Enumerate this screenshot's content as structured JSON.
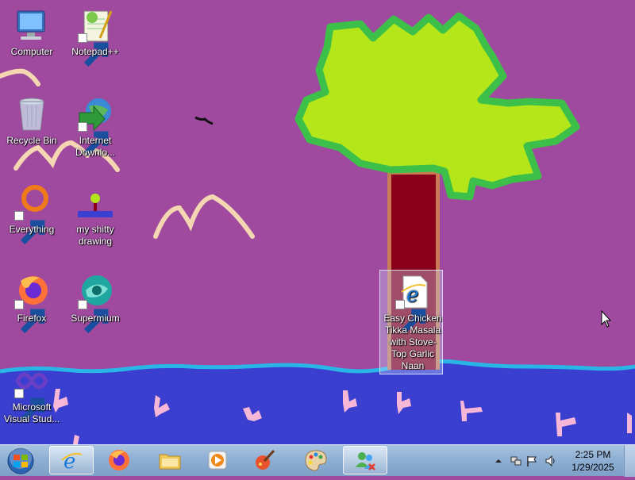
{
  "desktop": {
    "icons": [
      {
        "label": "Computer",
        "icon": "computer-icon"
      },
      {
        "label": "Notepad++",
        "icon": "notepad-plus-plus-icon"
      },
      {
        "label": "Recycle Bin",
        "icon": "recycle-bin-icon"
      },
      {
        "label": "Internet Downlo...",
        "icon": "internet-download-manager-icon"
      },
      {
        "label": "Everything",
        "icon": "everything-search-icon"
      },
      {
        "label": "my shitty drawing",
        "icon": "paint-image-icon"
      },
      {
        "label": "Firefox",
        "icon": "firefox-icon"
      },
      {
        "label": "Supermium",
        "icon": "supermium-icon"
      },
      {
        "label": "Microsoft Visual Stud...",
        "icon": "visual-studio-icon"
      },
      {
        "label": "Easy Chicken Tikka Masala with Stove-Top Garlic Naan",
        "icon": "internet-shortcut-icon",
        "selected": true
      }
    ]
  },
  "taskbar": {
    "start": {
      "icon": "windows-start-orb-icon"
    },
    "pinned": [
      {
        "name": "Internet Explorer",
        "icon": "internet-explorer-icon",
        "active": true
      },
      {
        "name": "Firefox",
        "icon": "firefox-icon"
      },
      {
        "name": "Windows Explorer",
        "icon": "folder-icon"
      },
      {
        "name": "Media Player",
        "icon": "media-player-icon"
      },
      {
        "name": "Paint tool",
        "icon": "paint-brush-icon"
      },
      {
        "name": "Paint",
        "icon": "paint-palette-icon"
      },
      {
        "name": "Network",
        "icon": "network-users-icon",
        "active": true
      }
    ],
    "tray": {
      "icons": [
        "show-hidden-icons-arrow",
        "network-icon",
        "action-center-flag-icon",
        "volume-icon"
      ],
      "time": "2:25 PM",
      "date": "1/29/2025"
    }
  },
  "colors": {
    "wallpaper_background": "#9f4a9f",
    "water": "#3a3fd0",
    "shoreline": "#29b6e6",
    "tree_canopy": "#b4e619",
    "tree_outline": "#3cc04a",
    "trunk": "#8a001a",
    "trunk_outline": "#c97b55",
    "birds": "#f5d6b2",
    "fish": "#f7b8d8",
    "taskbar": "#8fb0d4"
  }
}
